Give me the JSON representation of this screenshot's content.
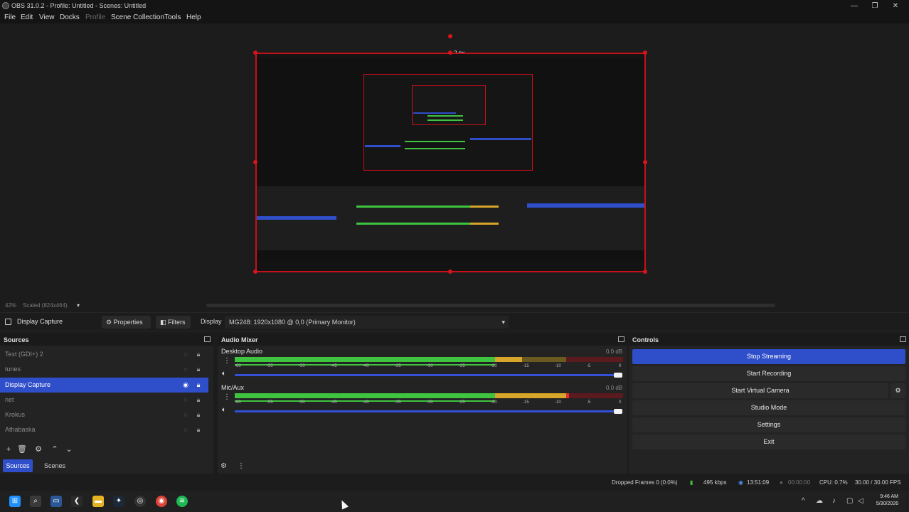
{
  "window": {
    "title": "OBS 31.0.2 - Profile: Untitled - Scenes: Untitled",
    "controls": [
      "—",
      "❐",
      "✕"
    ]
  },
  "menu": [
    "File",
    "Edit",
    "View",
    "Docks",
    "Profile",
    "Scene Collection",
    "Tools",
    "Help"
  ],
  "preview": {
    "crop_label": "2 px",
    "zoom": "42%",
    "scale_label": "Scaled (824x464)"
  },
  "source_toolbar": {
    "selected_source": "Display Capture",
    "properties_label": "Properties",
    "filters_label": "Filters",
    "display_label": "Display",
    "display_value": "MG248: 1920x1080 @ 0,0 (Primary Monitor)"
  },
  "sources": {
    "title": "Sources",
    "items": [
      {
        "label": "Text (GDI+) 2",
        "selected": false
      },
      {
        "label": "tunes",
        "selected": false
      },
      {
        "label": "Display Capture",
        "selected": true
      },
      {
        "label": "net",
        "selected": false
      },
      {
        "label": "Krokus",
        "selected": false
      },
      {
        "label": "Athabaska",
        "selected": false
      }
    ],
    "tabs": [
      "Sources",
      "Scenes"
    ]
  },
  "audio_mixer": {
    "title": "Audio Mixer",
    "channels": [
      {
        "name": "Desktop Audio",
        "db": "0.0 dB",
        "level": 0.72
      },
      {
        "name": "Mic/Aux",
        "db": "0.0 dB",
        "level": 0.82
      }
    ],
    "scale": [
      "-60",
      "-55",
      "-50",
      "-45",
      "-40",
      "-35",
      "-30",
      "-25",
      "-20",
      "-15",
      "-10",
      "-5",
      "0"
    ]
  },
  "controls": {
    "title": "Controls",
    "buttons": [
      "Stop Streaming",
      "Start Recording",
      "Start Virtual Camera",
      "Studio Mode",
      "Settings",
      "Exit"
    ]
  },
  "statusbar": {
    "dropped_frames": "Dropped Frames 0 (0.0%)",
    "kbps": "495 kbps",
    "stream_time": "13:51:09",
    "rec_time": "00:00:00",
    "cpu": "CPU: 0.7%",
    "fps": "30.00 / 30.00 FPS"
  },
  "taskbar": {
    "time": "9:46 AM",
    "date": "5/30/2026"
  },
  "colors": {
    "accent": "#2f4ec9",
    "crop_border": "#c8101a",
    "meter_green": "#3fc43f",
    "meter_yellow": "#d6a52a",
    "meter_red": "#b3222a"
  }
}
